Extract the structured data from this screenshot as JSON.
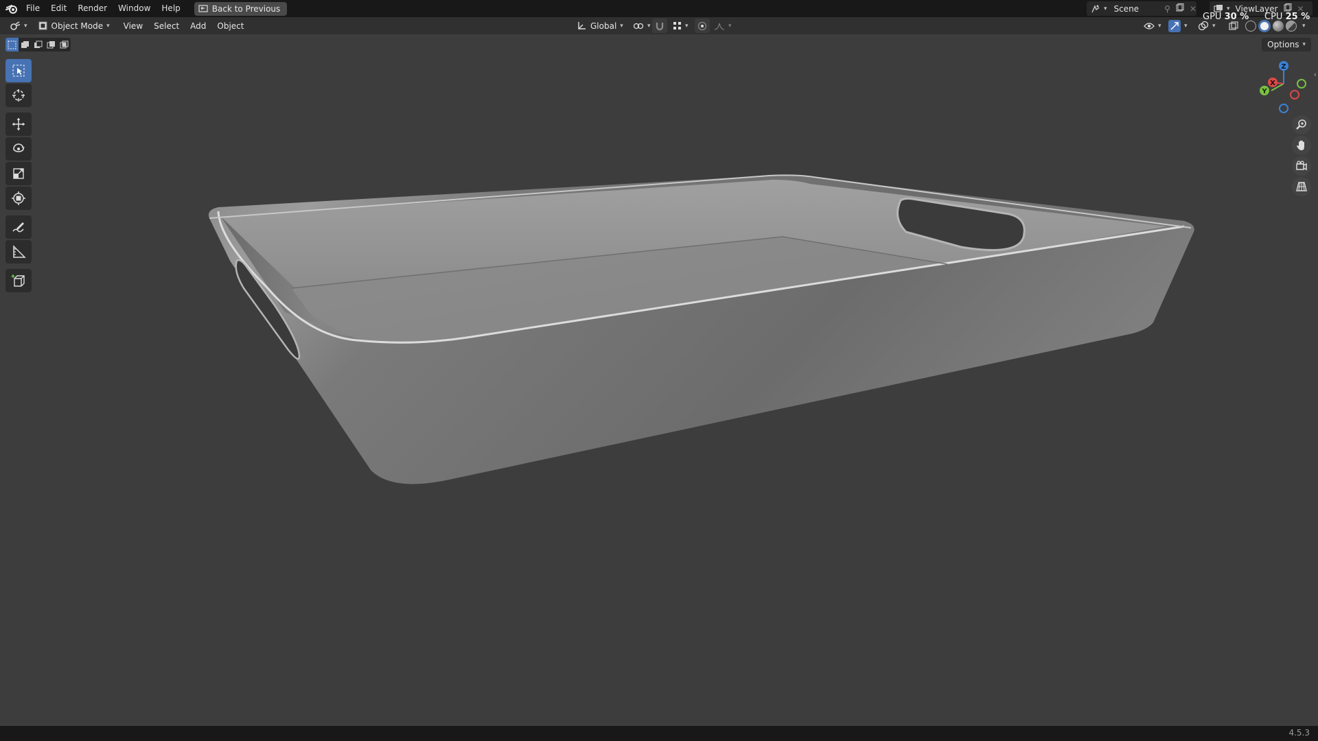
{
  "topbar": {
    "menus": [
      "File",
      "Edit",
      "Render",
      "Window",
      "Help"
    ],
    "back_button": "Back to Previous",
    "scene_name": "Scene",
    "view_layer": "ViewLayer"
  },
  "stats": {
    "gpu_label": "GPU",
    "gpu_value": "30 %",
    "cpu_label": "CPU",
    "cpu_value": "25 %"
  },
  "header": {
    "mode": "Object Mode",
    "menus": [
      "View",
      "Select",
      "Add",
      "Object"
    ],
    "transform_orientation": "Global",
    "options_label": "Options"
  },
  "gizmo": {
    "x": "X",
    "y": "Y",
    "z": "Z"
  },
  "tools": [
    "select-box",
    "cursor",
    "move",
    "rotate",
    "scale",
    "transform",
    "annotate",
    "measure",
    "add-cube"
  ],
  "status": {
    "version": "4.5.3"
  },
  "colors": {
    "accent": "#4772b3",
    "viewport": "#3d3d3d",
    "header": "#303030",
    "topbar": "#181818"
  }
}
